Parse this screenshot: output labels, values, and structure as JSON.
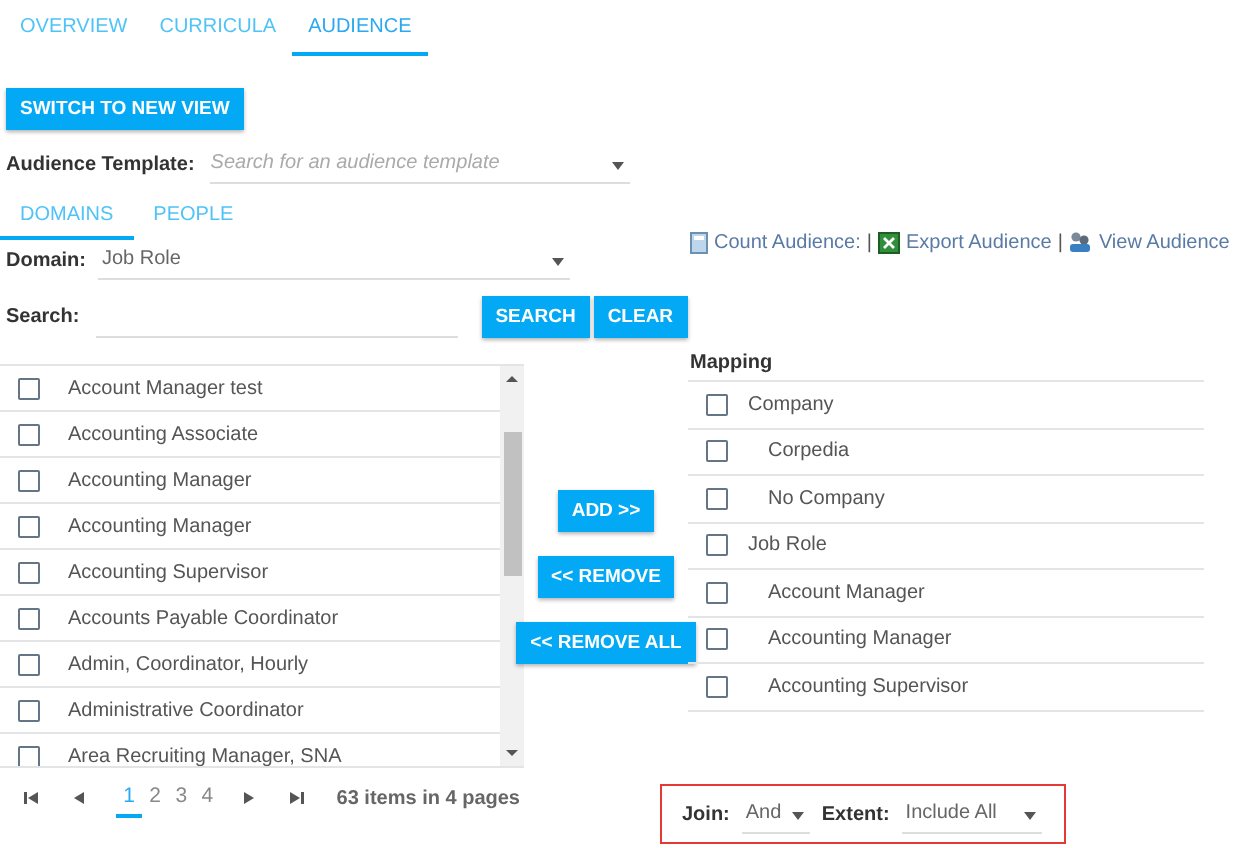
{
  "tabs": [
    {
      "label": "OVERVIEW",
      "selected": false
    },
    {
      "label": "CURRICULA",
      "selected": false
    },
    {
      "label": "AUDIENCE",
      "selected": true
    }
  ],
  "switch_button": "SWITCH TO NEW VIEW",
  "audience_template": {
    "label": "Audience Template:",
    "placeholder": "Search for an audience template"
  },
  "sub_tabs": [
    {
      "label": "DOMAINS",
      "selected": true
    },
    {
      "label": "PEOPLE",
      "selected": false
    }
  ],
  "domain": {
    "label": "Domain:",
    "value": "Job Role"
  },
  "search": {
    "label": "Search:",
    "buttons": [
      "SEARCH",
      "CLEAR"
    ]
  },
  "links": [
    {
      "kind": "count",
      "label": "Count Audience:",
      "separator": "|"
    },
    {
      "kind": "export",
      "label": "Export Audience",
      "separator": "|"
    },
    {
      "kind": "view",
      "label": "View Audience"
    }
  ],
  "domain_list": [
    {
      "label": "Account Manager test",
      "checked": false
    },
    {
      "label": "Accounting Associate",
      "checked": false
    },
    {
      "label": "Accounting Manager",
      "checked": false
    },
    {
      "label": "Accounting Manager",
      "checked": false
    },
    {
      "label": "Accounting Supervisor",
      "checked": false
    },
    {
      "label": "Accounts Payable Coordinator",
      "checked": false
    },
    {
      "label": "Admin, Coordinator, Hourly",
      "checked": false
    },
    {
      "label": "Administrative Coordinator",
      "checked": false
    },
    {
      "label": "Area Recruiting Manager, SNA",
      "checked": false
    }
  ],
  "transfer_buttons": [
    "ADD >>",
    "<< REMOVE",
    "<< REMOVE ALL"
  ],
  "mapping": {
    "title": "Mapping",
    "items": [
      {
        "label": "Company",
        "checked": false,
        "children": [
          {
            "label": "Corpedia",
            "checked": false
          },
          {
            "label": "No Company",
            "checked": false
          }
        ]
      },
      {
        "label": "Job Role",
        "checked": false,
        "children": [
          {
            "label": "Account Manager",
            "checked": false
          },
          {
            "label": "Accounting Manager",
            "checked": false
          },
          {
            "label": "Accounting Supervisor",
            "checked": false
          }
        ]
      }
    ]
  },
  "pager": {
    "pages": [
      {
        "label": "1",
        "selected": true
      },
      {
        "label": "2",
        "selected": false
      },
      {
        "label": "3",
        "selected": false
      },
      {
        "label": "4",
        "selected": false
      }
    ],
    "summary": "63 items in 4 pages"
  },
  "join_extent": {
    "highlighted": true,
    "join": {
      "label": "Join:",
      "value": "And"
    },
    "extent": {
      "label": "Extent:",
      "value": "Include All"
    }
  }
}
